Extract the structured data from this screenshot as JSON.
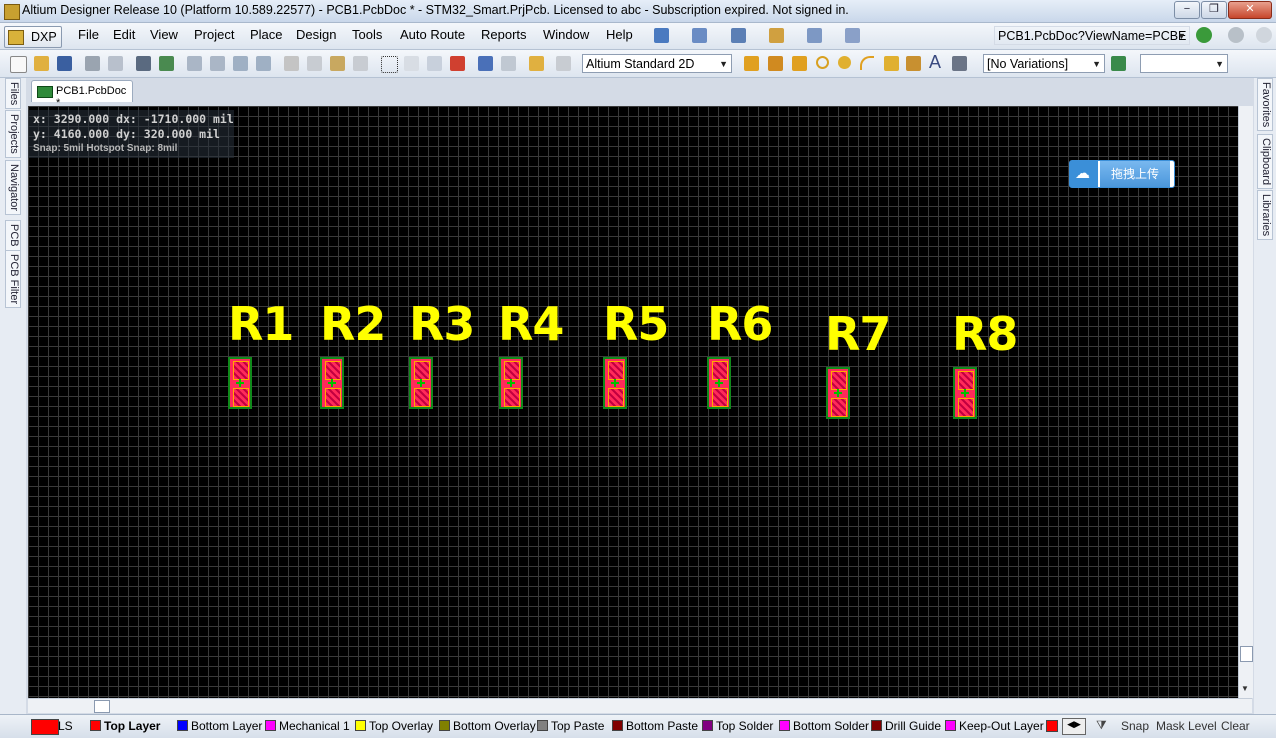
{
  "window": {
    "title": "Altium Designer Release 10 (Platform 10.589.22577) - PCB1.PcbDoc * - STM32_Smart.PrjPcb. Licensed to abc - Subscription expired. Not signed in.",
    "min": "−",
    "max": "❐",
    "close": "✕"
  },
  "menu": {
    "dxp": "DXP",
    "items": [
      "File",
      "Edit",
      "View",
      "Project",
      "Place",
      "Design",
      "Tools",
      "Auto Route",
      "Reports",
      "Window",
      "Help"
    ],
    "address": "PCB1.PcbDoc?ViewName=PCBE"
  },
  "toolbar": {
    "view_mode": "Altium Standard 2D",
    "variations": "[No Variations]",
    "blank_combo": ""
  },
  "left_panels": [
    "Files",
    "Projects",
    "Navigator",
    "PCB",
    "PCB Filter"
  ],
  "right_panels": [
    "Favorites",
    "Clipboard",
    "Libraries"
  ],
  "document_tab": "PCB1.PcbDoc *",
  "coords": {
    "line1": "x:  3290.000   dx: -1710.000  mil",
    "line2": "y:  4160.000   dy:   320.000  mil",
    "line3": "Snap: 5mil Hotspot Snap: 8mil"
  },
  "upload_button": {
    "icon": "cloud-icon",
    "label": "拖拽上传"
  },
  "components": [
    "R1",
    "R2",
    "R3",
    "R4",
    "R5",
    "R6",
    "R7",
    "R8"
  ],
  "layers": [
    {
      "name": "Top Layer",
      "color": "#ff0000",
      "active": true
    },
    {
      "name": "Bottom Layer",
      "color": "#0000ff"
    },
    {
      "name": "Mechanical 1",
      "color": "#ff00ff"
    },
    {
      "name": "Top Overlay",
      "color": "#ffff00"
    },
    {
      "name": "Bottom Overlay",
      "color": "#808000"
    },
    {
      "name": "Top Paste",
      "color": "#808080"
    },
    {
      "name": "Bottom Paste",
      "color": "#800000"
    },
    {
      "name": "Top Solder",
      "color": "#800080"
    },
    {
      "name": "Bottom Solder",
      "color": "#ff00ff"
    },
    {
      "name": "Drill Guide",
      "color": "#800000"
    },
    {
      "name": "Keep-Out Layer",
      "color": "#ff00ff"
    }
  ],
  "layer_set": "LS",
  "status": {
    "snap": "Snap",
    "mask_level": "Mask Level",
    "clear": "Clear"
  }
}
